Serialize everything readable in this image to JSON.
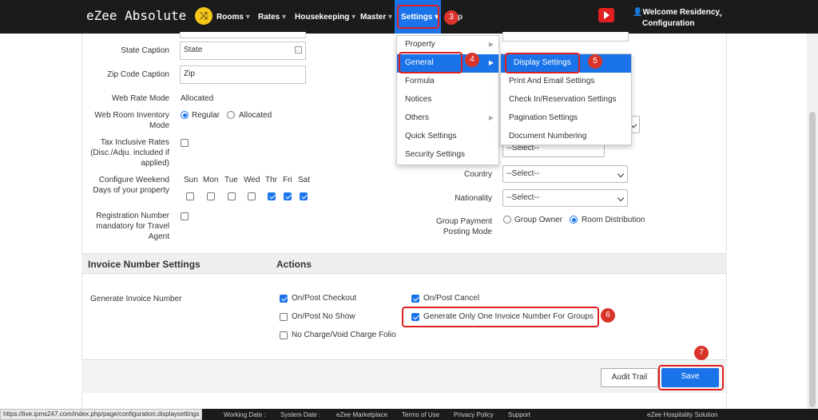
{
  "topbar": {
    "brand": "eZee Absolute",
    "nav": [
      {
        "label": "Rooms"
      },
      {
        "label": "Rates"
      },
      {
        "label": "Housekeeping"
      },
      {
        "label": "Master"
      },
      {
        "label": "Settings"
      }
    ],
    "settings_suffix": "p",
    "welcome_line1": "Welcome Residency",
    "welcome_line2": "Configuration",
    "accent": "#1a73e8"
  },
  "form_left": {
    "state_caption": {
      "label": "State Caption",
      "value": "State"
    },
    "zip_caption": {
      "label": "Zip Code Caption",
      "value": "Zip"
    },
    "web_rate_mode": {
      "label": "Web Rate Mode",
      "value": "Allocated"
    },
    "web_room_inventory": {
      "label": "Web Room Inventory Mode",
      "options": [
        "Regular",
        "Allocated"
      ],
      "selected": "Regular"
    },
    "tax_inclusive": {
      "label": "Tax Inclusive Rates (Disc./Adju. included if applied)",
      "checked": false
    },
    "weekend": {
      "label": "Configure Weekend Days of your property",
      "days": [
        {
          "name": "Sun",
          "checked": false
        },
        {
          "name": "Mon",
          "checked": false
        },
        {
          "name": "Tue",
          "checked": false
        },
        {
          "name": "Wed",
          "checked": false
        },
        {
          "name": "Thr",
          "checked": true
        },
        {
          "name": "Fri",
          "checked": true
        },
        {
          "name": "Sat",
          "checked": true
        }
      ]
    },
    "registration": {
      "label": "Registration Number mandatory for Travel Agent",
      "checked": false
    }
  },
  "form_right": {
    "select_placeholder": "--Select--",
    "country_label": "Country",
    "nationality_label": "Nationality",
    "group_payment_label": "Group Payment Posting Mode",
    "group_payment_options": [
      "Group Owner",
      "Room Distribution"
    ],
    "group_payment_selected": "Room Distribution"
  },
  "invoice": {
    "section_title": "Invoice Number Settings",
    "actions_title": "Actions",
    "row_label": "Generate Invoice Number",
    "options": [
      {
        "label": "On/Post Checkout",
        "checked": true
      },
      {
        "label": "On/Post Cancel",
        "checked": true
      },
      {
        "label": "On/Post No Show",
        "checked": false
      },
      {
        "label": "Generate Only One Invoice Number For Groups",
        "checked": true
      },
      {
        "label": "No Charge/Void Charge Folio",
        "checked": false
      }
    ]
  },
  "buttons": {
    "audit_trail": "Audit Trail",
    "save": "Save"
  },
  "settings_menu": {
    "items": [
      {
        "label": "Property",
        "has_sub": true
      },
      {
        "label": "General",
        "has_sub": true
      },
      {
        "label": "Formula",
        "has_sub": false
      },
      {
        "label": "Notices",
        "has_sub": false
      },
      {
        "label": "Others",
        "has_sub": true
      },
      {
        "label": "Quick Settings",
        "has_sub": false
      },
      {
        "label": "Security Settings",
        "has_sub": false
      }
    ]
  },
  "general_submenu": {
    "items": [
      {
        "label": "Display Settings"
      },
      {
        "label": "Print And Email Settings"
      },
      {
        "label": "Check In/Reservation Settings"
      },
      {
        "label": "Pagination Settings"
      },
      {
        "label": "Document Numbering"
      }
    ]
  },
  "steps": {
    "s3": "3",
    "s4": "4",
    "s5": "5",
    "s6": "6",
    "s7": "7"
  },
  "bottom": {
    "status_url": "https://live.ipms247.com/index.php/page/configuration.displaysettings",
    "working_date": "Working Date :",
    "system_date": "System Date :",
    "ezee_market": "eZee Marketplace",
    "terms": "Terms of Use",
    "privacy": "Privacy Policy",
    "support": "Support",
    "company": "eZee Hospitality Solution"
  }
}
